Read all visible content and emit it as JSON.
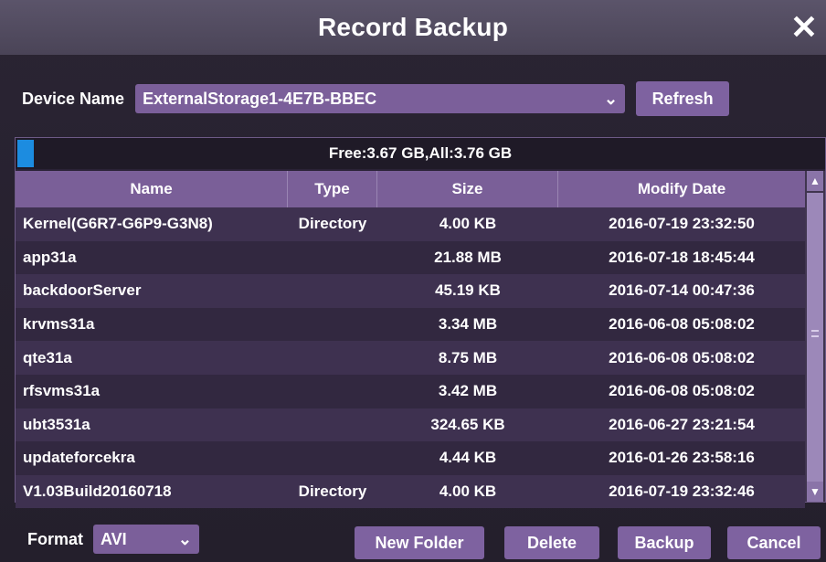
{
  "window": {
    "title": "Record Backup",
    "close_label": "✕"
  },
  "device": {
    "label": "Device Name",
    "selected": "ExternalStorage1-4E7B-BBEC",
    "refresh_label": "Refresh"
  },
  "storage": {
    "text": "Free:3.67 GB,All:3.76 GB",
    "used_fraction": 0.02
  },
  "table": {
    "columns": [
      "Name",
      "Type",
      "Size",
      "Modify Date"
    ],
    "rows": [
      {
        "name": "Kernel(G6R7-G6P9-G3N8)",
        "type": "Directory",
        "size": "4.00 KB",
        "date": "2016-07-19 23:32:50"
      },
      {
        "name": "app31a",
        "type": "",
        "size": "21.88 MB",
        "date": "2016-07-18 18:45:44"
      },
      {
        "name": "backdoorServer",
        "type": "",
        "size": "45.19 KB",
        "date": "2016-07-14 00:47:36"
      },
      {
        "name": "krvms31a",
        "type": "",
        "size": "3.34 MB",
        "date": "2016-06-08 05:08:02"
      },
      {
        "name": "qte31a",
        "type": "",
        "size": "8.75 MB",
        "date": "2016-06-08 05:08:02"
      },
      {
        "name": "rfsvms31a",
        "type": "",
        "size": "3.42 MB",
        "date": "2016-06-08 05:08:02"
      },
      {
        "name": "ubt3531a",
        "type": "",
        "size": "324.65 KB",
        "date": "2016-06-27 23:21:54"
      },
      {
        "name": "updateforcekra",
        "type": "",
        "size": "4.44 KB",
        "date": "2016-01-26 23:58:16"
      },
      {
        "name": "V1.03Build20160718",
        "type": "Directory",
        "size": "4.00 KB",
        "date": "2016-07-19 23:32:46"
      }
    ]
  },
  "footer": {
    "format_label": "Format",
    "format_value": "AVI",
    "new_folder_label": "New Folder",
    "delete_label": "Delete",
    "backup_label": "Backup",
    "cancel_label": "Cancel"
  },
  "icons": {
    "close": "close-icon",
    "dropdown": "chevron-down-icon",
    "scroll_up": "scroll-up-arrow-icon",
    "scroll_down": "scroll-down-arrow-icon"
  },
  "colors": {
    "accent": "#7e62a0",
    "titlebar": "#4f4860",
    "storage_fill": "#1c8ce0",
    "row_odd": "#3e3150",
    "row_even": "#322840"
  }
}
